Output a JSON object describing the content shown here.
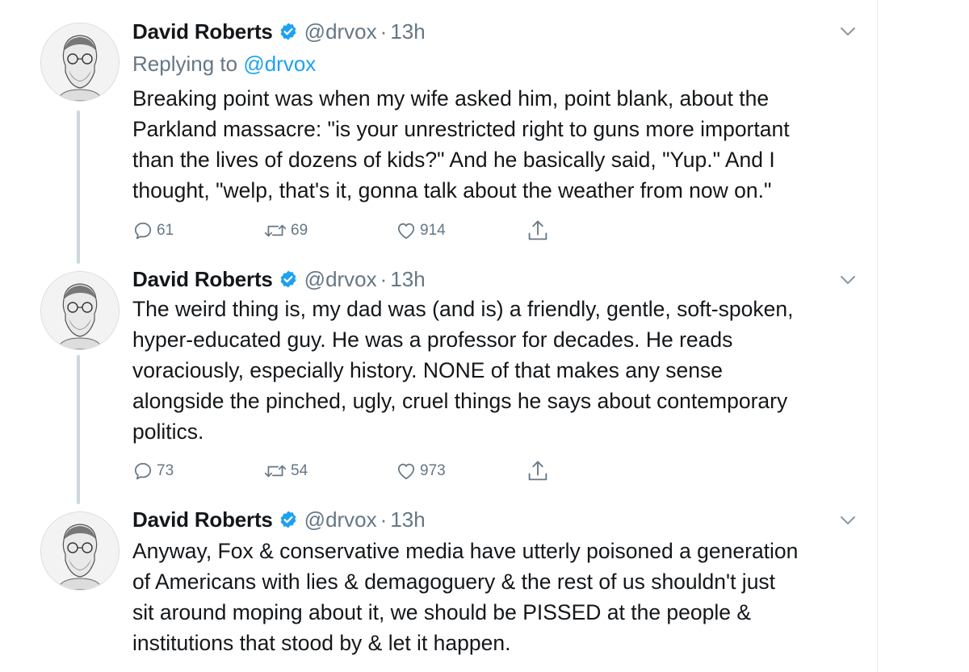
{
  "tweets": [
    {
      "author": {
        "name": "David Roberts",
        "handle": "@drvox"
      },
      "time": "13h",
      "dot": "·",
      "reply_prefix": "Replying to",
      "reply_to": "@drvox",
      "text": "Breaking point was when my wife asked him, point blank, about the\nParkland massacre: \"is your unrestricted right to guns more important\nthan the lives of dozens of kids?\" And he basically said, \"Yup.\" And I\nthought, \"welp, that's it, gonna talk about the weather from now on.\"",
      "replies": "61",
      "retweets": "69",
      "likes": "914"
    },
    {
      "author": {
        "name": "David Roberts",
        "handle": "@drvox"
      },
      "time": "13h",
      "dot": "·",
      "text": "The weird thing is, my dad was (and is) a friendly, gentle, soft-spoken,\nhyper-educated guy. He was a professor for decades. He reads\nvoraciously, especially history. NONE of that makes any sense\nalongside the pinched, ugly, cruel things he says about contemporary\npolitics.",
      "replies": "73",
      "retweets": "54",
      "likes": "973"
    },
    {
      "author": {
        "name": "David Roberts",
        "handle": "@drvox"
      },
      "time": "13h",
      "dot": "·",
      "text": "Anyway, Fox & conservative media have utterly poisoned a generation\nof Americans with lies & demagoguery & the rest of us shouldn't just\nsit around moping about it, we should be PISSED at the people &\ninstitutions that stood by & let it happen."
    }
  ],
  "icons": {
    "reply": "reply-icon",
    "retweet": "retweet-icon",
    "like": "heart-icon",
    "share": "share-icon",
    "verified": "verified-badge-icon",
    "chevron": "chevron-down-icon"
  },
  "colors": {
    "text": "#14171a",
    "secondary": "#657786",
    "link": "#1da1f2",
    "verified": "#1da1f2",
    "thread_line": "#ccd6dd"
  }
}
